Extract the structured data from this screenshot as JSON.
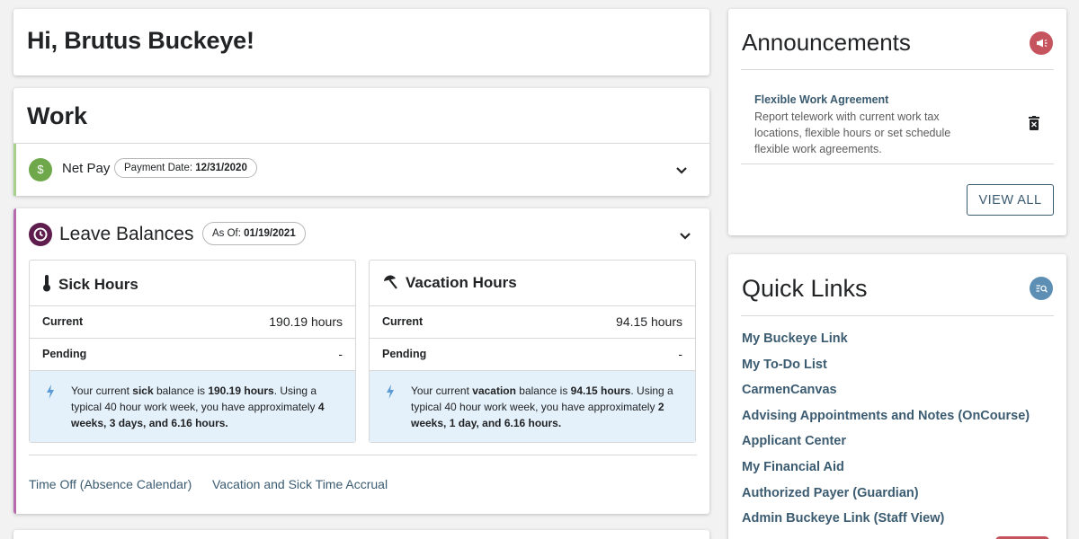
{
  "greeting": "Hi, Brutus Buckeye!",
  "work": {
    "title": "Work",
    "net_pay": {
      "label": "Net Pay",
      "date_label": "Payment Date:",
      "date": "12/31/2020"
    }
  },
  "leave": {
    "title": "Leave Balances",
    "asof_label": "As Of:",
    "asof_date": "01/19/2021",
    "sick": {
      "title": "Sick Hours",
      "current_label": "Current",
      "current_value": "190.19 hours",
      "pending_label": "Pending",
      "pending_value": "-",
      "info_pre": "Your current ",
      "info_type": "sick",
      "info_mid": " balance is ",
      "info_balance": "190.19 hours",
      "info_post": ". Using a typical 40 hour work week, you have approximately ",
      "info_approx": "4 weeks, 3 days, and 6.16 hours."
    },
    "vacation": {
      "title": "Vacation Hours",
      "current_label": "Current",
      "current_value": "94.15 hours",
      "pending_label": "Pending",
      "pending_value": "-",
      "info_pre": "Your current ",
      "info_type": "vacation",
      "info_mid": " balance is ",
      "info_balance": "94.15 hours",
      "info_post": ". Using a typical 40 hour work week, you have approximately ",
      "info_approx": "2 weeks, 1 day, and 6.16 hours."
    },
    "links": [
      "Time Off (Absence Calendar)",
      "Vacation and Sick Time Accrual"
    ]
  },
  "announcements": {
    "title": "Announcements",
    "item_title": "Flexible Work Agreement",
    "item_desc": "Report telework with current work tax locations, flexible hours or set schedule flexible work agreements.",
    "view_all": "VIEW ALL"
  },
  "quick_links": {
    "title": "Quick Links",
    "items": [
      "My Buckeye Link",
      "My To-Do List",
      "CarmenCanvas",
      "Advising Appointments and Notes (OnCourse)",
      "Applicant Center",
      "My Financial Aid",
      "Authorized Payer (Guardian)",
      "Admin Buckeye Link (Staff View)"
    ]
  },
  "icons": {
    "net_pay": "dollar-icon",
    "leave": "clock-icon",
    "sick": "thermometer-icon",
    "vacation": "umbrella-icon",
    "info": "lightning-icon",
    "announcements": "megaphone-icon",
    "quick_links": "search-list-icon",
    "trash": "trash-icon"
  },
  "colors": {
    "link": "#3b5b71",
    "net_pay_accent": "#6fa84a",
    "leave_accent": "#5e1d4d",
    "leave_border": "#b66aaf",
    "announcement_badge": "#c5545e",
    "quick_links_badge": "#5d8fb5",
    "info_bg": "#e5f1fa"
  }
}
